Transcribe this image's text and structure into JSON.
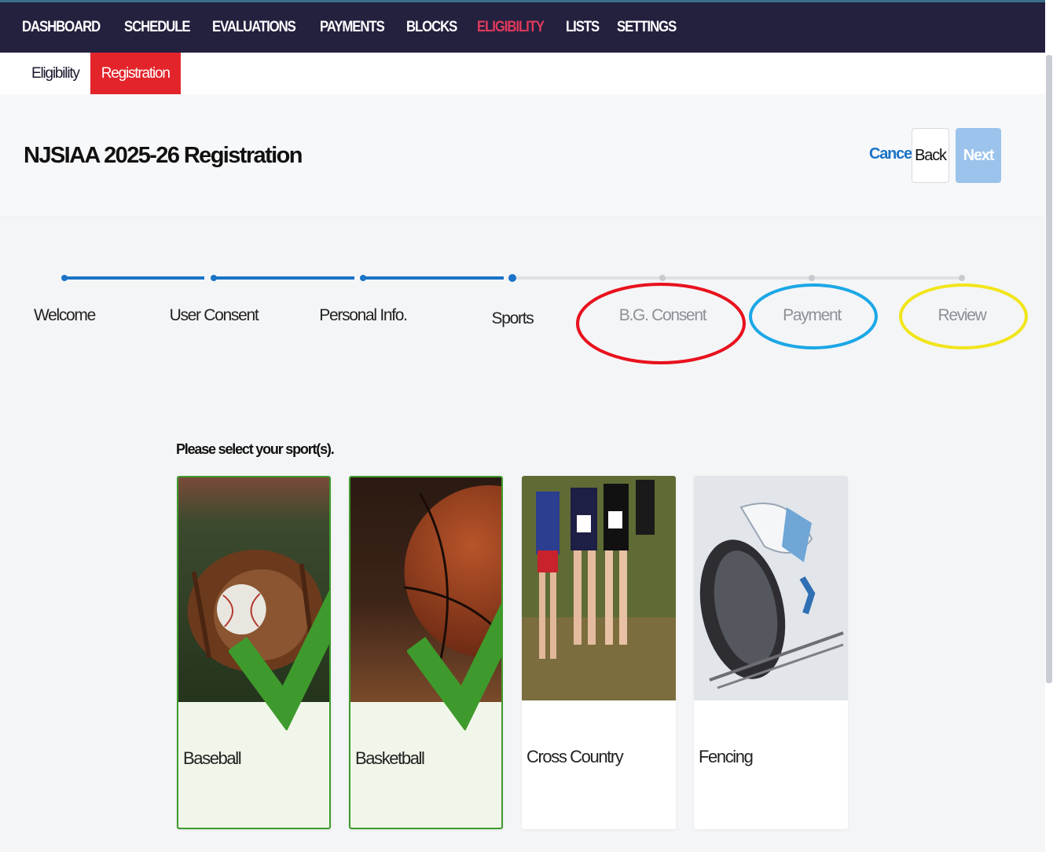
{
  "topnav": {
    "items": [
      "DASHBOARD",
      "SCHEDULE",
      "EVALUATIONS",
      "PAYMENTS",
      "BLOCKS",
      "ELIGIBILITY",
      "LISTS",
      "SETTINGS"
    ],
    "active": "ELIGIBILITY"
  },
  "subnav": {
    "items": [
      "Eligibility",
      "Registration"
    ],
    "active": "Registration"
  },
  "header": {
    "title": "NJSIAA 2025-26 Registration",
    "cancel_label": "Cancel",
    "back_label": "Back",
    "next_label": "Next"
  },
  "stepper": {
    "steps": [
      "Welcome",
      "User Consent",
      "Personal Info.",
      "Sports",
      "B.G. Consent",
      "Payment",
      "Review"
    ],
    "current_step": 4,
    "completed_color": "#1a73c7",
    "pending_color": "#dfe1e5"
  },
  "sports": {
    "prompt": "Please select your sport(s).",
    "cards": [
      {
        "label": "Baseball",
        "image": "baseball-glove-image",
        "selected": true
      },
      {
        "label": "Basketball",
        "image": "basketball-image",
        "selected": true
      },
      {
        "label": "Cross Country",
        "image": "cross-country-runners-image",
        "selected": false
      },
      {
        "label": "Fencing",
        "image": "fencing-gear-image",
        "selected": false
      }
    ]
  },
  "annotations": {
    "colors": [
      "#e8121d",
      "#1ba7e6",
      "#f1e51a"
    ]
  },
  "colors": {
    "nav_bg": "#24213f",
    "active_nav": "#e23a5c",
    "active_tab": "#e3242b",
    "accent": "#1a73c7",
    "check": "#3e9a2c"
  }
}
